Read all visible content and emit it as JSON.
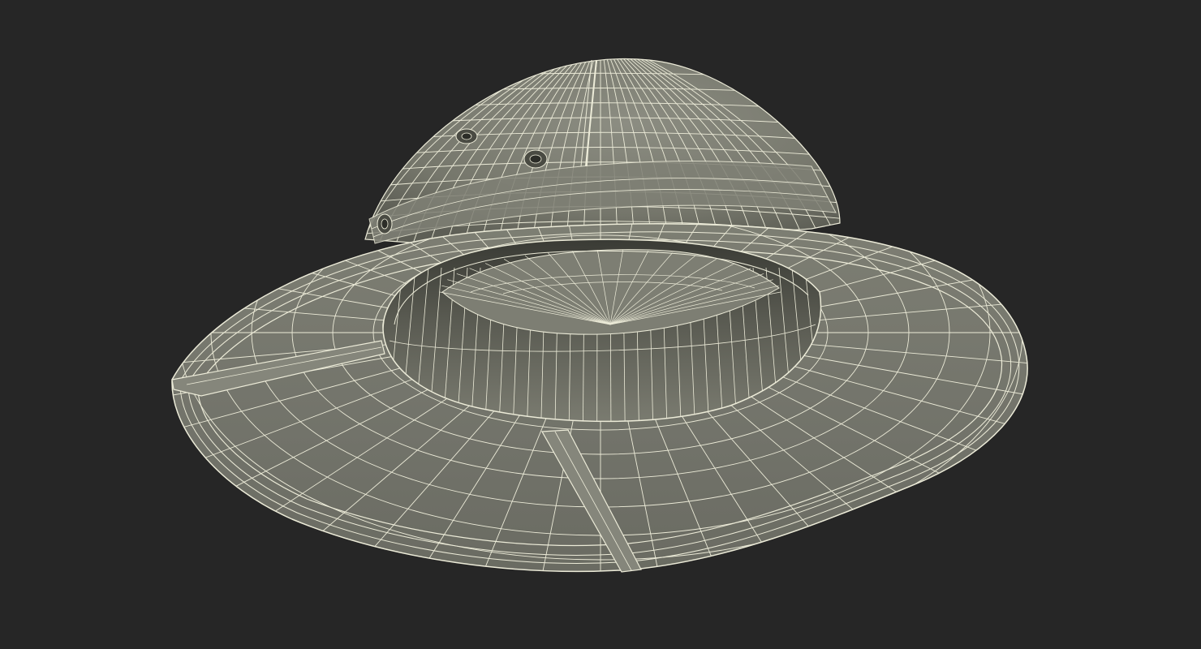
{
  "viewport": {
    "background": "#262626"
  },
  "model": {
    "subject": "pith-helmet-wireframe",
    "render_mode": "shaded-wireframe",
    "colors": {
      "surface": "#7a7b70",
      "surface_light": "#8a8b80",
      "surface_dark": "#4a4b43",
      "inner_shadow": "#2f302b",
      "wire": "#ecebd8"
    }
  }
}
